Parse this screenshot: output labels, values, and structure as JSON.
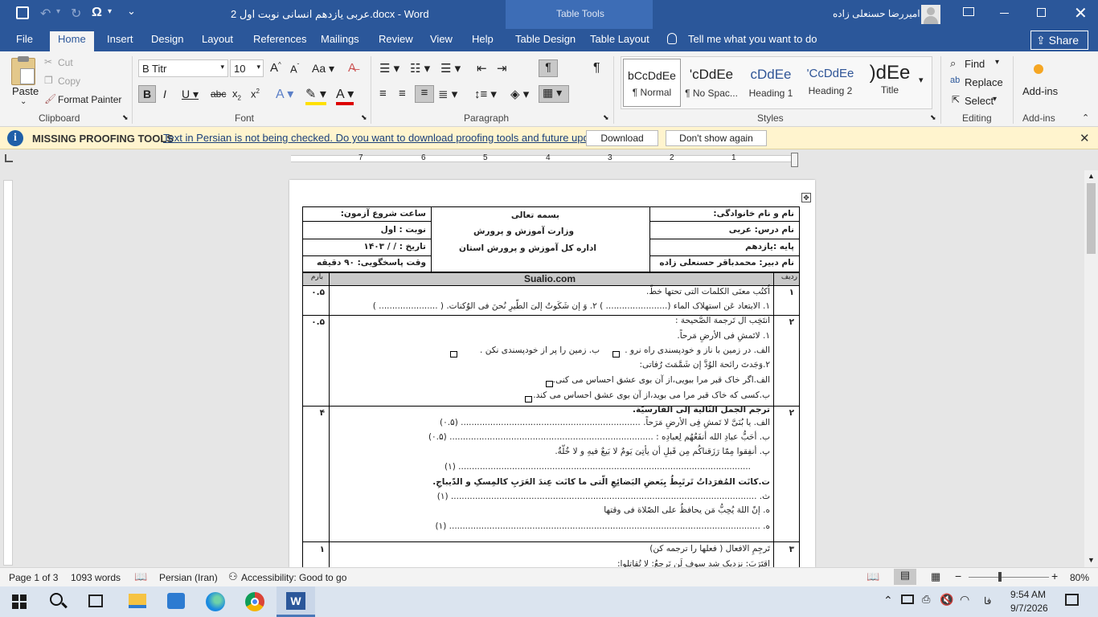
{
  "titlebar": {
    "doc_title": "عربی یازدهم انسانی نوبت اول 2.docx  -  Word",
    "context_label": "Table Tools",
    "user_name": "امیررضا حسنعلی زاده",
    "qat_redo_glyph": "↻",
    "qat_omega": "Ω",
    "qat_more": "⌄"
  },
  "tabs": [
    "File",
    "Home",
    "Insert",
    "Design",
    "Layout",
    "References",
    "Mailings",
    "Review",
    "View",
    "Help",
    "Table Design",
    "Table Layout"
  ],
  "tell_me": "Tell me what you want to do",
  "share_label": "Share",
  "clipboard": {
    "paste": "Paste",
    "cut": "Cut",
    "copy": "Copy",
    "format_painter": "Format Painter",
    "group": "Clipboard"
  },
  "font": {
    "name": "B Titr",
    "size": "10",
    "group": "Font"
  },
  "paragraph": {
    "group": "Paragraph"
  },
  "styles": {
    "group": "Styles",
    "items": [
      {
        "preview": "bCcDdEe",
        "name": "¶ Normal"
      },
      {
        "preview": "'cDdEe",
        "name": "¶ No Spac..."
      },
      {
        "preview": "cDdEe",
        "name": "Heading 1"
      },
      {
        "preview": "'CcDdEe",
        "name": "Heading 2"
      },
      {
        "preview": ")dEe",
        "name": "Title"
      }
    ]
  },
  "editing": {
    "find": "Find",
    "replace": "Replace",
    "select": "Select",
    "group": "Editing"
  },
  "addins": {
    "label": "Add-ins",
    "group": "Add-ins"
  },
  "message": {
    "title": "MISSING PROOFING TOOLS",
    "text": "Text in Persian is not being checked. Do you want to download proofing tools and future updates?",
    "download": "Download",
    "dont_show": "Don't show again"
  },
  "ruler_numbers": [
    "7",
    "6",
    "5",
    "4",
    "3",
    "2",
    "1"
  ],
  "doc": {
    "header": {
      "name": "نام و نام خانوادگی:",
      "course": "نام درس: عربی",
      "grade": "پایه :یازدهم",
      "teacher": "نام دبیر: محمدباقر حسنعلی زاده",
      "center1": "بسمه تعالی",
      "center2": "وزارت آموزش و پرورش",
      "center3": "اداره کل آموزش و پرورش استان",
      "start": "ساعت شروع آزمون:",
      "turn": "نوبت    :  اول",
      "date": "تاریخ    :      /     /   ۱۴۰۳",
      "duration": "وقت پاسخگویی: ۹۰ دقیقه"
    },
    "col_row": "ردیف",
    "col_site": "Sualio.com",
    "col_score": "بارم",
    "rows": [
      {
        "num": "۱",
        "score": "۰.۵",
        "lines": [
          "اُکتُب معنَی الکلمات التی تحتها خطّ.",
          "۱. الابتعاد عَن استهلاک الماء (.......................    )    ۲. وَ إن شَکَوتُ إلیَ الطّیرِ نُحنَ فی الوُکنات. (  ......................   )"
        ]
      },
      {
        "num": "۲",
        "score": "۰.۵",
        "lines": [
          "انتَخِب ال تَرجمهَ الصَّحیحهَ :",
          "۱.  لاتَمشِ فی الأرضِ مَرحاً.",
          "الف. در زمین با ناز و خودپسندی راه نرو .",
          "ب. زمین را پر از خودپسندی نکن .",
          "۲.وَجَدتَ رائحهَ الوُدَّ إن شَمَّمَتَ رُفاتی:",
          "الف.اگر خاک قبر مرا ببویی،از آن بوی عشق احساس می کنی.",
          "ب.کسی که خاک قبر مرا می بوید،از آن بوی عشق احساس می کند."
        ]
      },
      {
        "num": "۲",
        "score": "۴",
        "lines": [
          "ترجم الجمل التّالیة إلی الفارسیّة.",
          "الف. یا بُنَیَّ لا تَمشِ فِی الأرضِ مَرَحاً. ................................................................... (۰.۵)",
          "ب. أحَبُّ عبادِ الله أنفَعُهُم لِعبادِه : ............................................................................ (۰.۵)",
          "پ. أنفِقوا مِمّا رَزَقناکُم مِن قَبلِ أن یأتِیَ یَومٌ لا بَیعٌ فیهِ و لا خُلّةٌ.",
          "............................................................................................................. (۱)",
          "ت.کانَت المُفرَداتُ تَرتَبِطُ بِبَعضِ البَضائِعِ الّتی ما کانَت عِندَ العَرَبِ کالمِسکِ و الدّیباجِ.",
          "ث. .................................................................................................................. (۱)",
          "ه. إنّ اللهَ یُحِبُّ مَن یحافظُ علی الصّلاة فی وقتها",
          "ه. .................................................................................................................... (۱)"
        ]
      },
      {
        "num": "۳",
        "score": "۱",
        "lines": [
          "تَرجِمِ الافعال  ( فعلها را ترجمه کن)",
          "اقتَرَبَ: نزدیک شد        سوف لَن نَرجِعُ:         لا تُقاتِلوا:"
        ]
      }
    ]
  },
  "status": {
    "page": "Page 1 of 3",
    "words": "1093 words",
    "language": "Persian (Iran)",
    "accessibility": "Accessibility: Good to go",
    "zoom": "80%"
  },
  "taskbar": {
    "time": "9:54 AM",
    "date": "9/7/2026",
    "lang": "فا"
  },
  "colors": {
    "word_blue": "#2b579a",
    "msg_bg": "#fff4ce",
    "ribbon_bg": "#f3f3f3"
  }
}
